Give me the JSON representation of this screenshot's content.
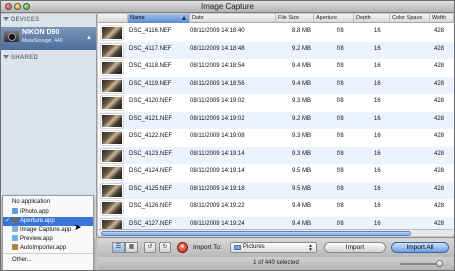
{
  "window": {
    "title": "Image Capture"
  },
  "sidebar": {
    "devices_header": "DEVICES",
    "shared_header": "SHARED",
    "device": {
      "name": "NIKON D90",
      "subtitle": "MassStorage, 440"
    }
  },
  "table": {
    "columns": [
      "Name",
      "Date",
      "File Size",
      "Aperture",
      "Depth",
      "Color Space",
      "Width"
    ],
    "rows": [
      {
        "name": "DSC_4116.NEF",
        "date": "08/11/2009 14:18:40",
        "size": "8.8 MB",
        "aperture": "f/8",
        "depth": "16",
        "width": "428"
      },
      {
        "name": "DSC_4117.NEF",
        "date": "08/11/2009 14:18:48",
        "size": "9.2 MB",
        "aperture": "f/8",
        "depth": "16",
        "width": "428"
      },
      {
        "name": "DSC_4118.NEF",
        "date": "08/11/2009 14:18:54",
        "size": "9.4 MB",
        "aperture": "f/8",
        "depth": "16",
        "width": "428"
      },
      {
        "name": "DSC_4119.NEF",
        "date": "08/11/2009 14:18:56",
        "size": "9.4 MB",
        "aperture": "f/8",
        "depth": "16",
        "width": "428"
      },
      {
        "name": "DSC_4120.NEF",
        "date": "08/11/2009 14:19:02",
        "size": "9.3 MB",
        "aperture": "f/8",
        "depth": "16",
        "width": "428"
      },
      {
        "name": "DSC_4121.NEF",
        "date": "08/11/2009 14:19:02",
        "size": "9.2 MB",
        "aperture": "f/8",
        "depth": "16",
        "width": "428"
      },
      {
        "name": "DSC_4122.NEF",
        "date": "08/11/2009 14:19:08",
        "size": "9.3 MB",
        "aperture": "f/8",
        "depth": "16",
        "width": "428"
      },
      {
        "name": "DSC_4123.NEF",
        "date": "08/11/2009 14:19:14",
        "size": "9.3 MB",
        "aperture": "f/8",
        "depth": "16",
        "width": "428"
      },
      {
        "name": "DSC_4124.NEF",
        "date": "08/11/2009 14:19:14",
        "size": "9.5 MB",
        "aperture": "f/8",
        "depth": "16",
        "width": "428"
      },
      {
        "name": "DSC_4125.NEF",
        "date": "08/11/2009 14:19:18",
        "size": "9.5 MB",
        "aperture": "f/8",
        "depth": "16",
        "width": "428"
      },
      {
        "name": "DSC_4126.NEF",
        "date": "08/11/2009 14:19:22",
        "size": "9.4 MB",
        "aperture": "f/8",
        "depth": "16",
        "width": "428"
      },
      {
        "name": "DSC_4127.NEF",
        "date": "08/11/2009 14:19:24",
        "size": "9.4 MB",
        "aperture": "f/8",
        "depth": "16",
        "width": "428"
      }
    ]
  },
  "menu": {
    "items": [
      {
        "label": "No application",
        "checked": false
      },
      {
        "label": "iPhoto.app",
        "checked": false
      },
      {
        "label": "Aperture.app",
        "checked": true
      },
      {
        "label": "Image Capture.app",
        "checked": false
      },
      {
        "label": "Preview.app",
        "checked": false
      },
      {
        "label": "AutoImporter.app",
        "checked": false
      },
      {
        "label": "Other...",
        "checked": false
      }
    ],
    "check_mark": "✓"
  },
  "toolbar": {
    "import_to_label": "Import To:",
    "destination": "Pictures",
    "import_button": "Import",
    "import_all_button": "Import All"
  },
  "status": {
    "text": "1 of 440 selected"
  },
  "colors": {
    "selection": "#3875d7",
    "sort_header": "#5b8bd0",
    "row_alt": "#edf3fe"
  }
}
